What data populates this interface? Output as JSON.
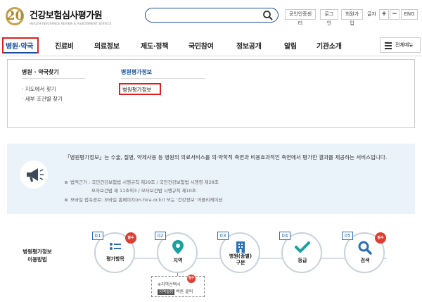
{
  "header": {
    "logo_number": "20",
    "logo_name": "건강보험심사평가원",
    "logo_sub": "HEALTH INSURANCE REVIEW & ASSESSMENT SERVICE",
    "search_placeholder": "",
    "utils": {
      "cert": "공인인증센터",
      "login": "로그인",
      "join": "회원가입",
      "font_label": "글자",
      "font_plus": "+",
      "font_minus": "−",
      "eng": "ENG"
    }
  },
  "gnb": {
    "items": [
      "병원·약국",
      "진료비",
      "의료정보",
      "제도·정책",
      "국민참여",
      "정보공개",
      "알림",
      "기관소개"
    ],
    "all_menu": "전체메뉴"
  },
  "dropdown": {
    "col1_title": "병원 · 약국찾기",
    "col1_links": [
      "지도에서 찾기",
      "세부 조건별 찾기"
    ],
    "col2_title": "병원평가정보",
    "col2_link": "병원평가정보"
  },
  "info": {
    "text": "「병원평가정보」는 수술, 질병, 약제사용 등 병원의 의료서비스를 의·약학적 측면과 비용효과적인 측면에서 평가한 결과를 제공하는 서비스입니다.",
    "law1": "법적근거 : 국민건강보험법 시행규칙 제29조 / 국민건강보험법 시행령 제28조",
    "law2": "모자보건법 제 11조의3 / 모자보건법 시행규칙 제10조",
    "mobile": "모바일 접속경로: 모바일 홈페이지(m.hira.or.kr) 또는 '건강정보' 어플리케이션"
  },
  "steps": {
    "title_line1": "병원평가정보",
    "title_line2": "이용방법",
    "required_label": "필수",
    "items": [
      {
        "num": "01",
        "label": "평가항목",
        "required": true
      },
      {
        "num": "02",
        "label": "지역",
        "required": false
      },
      {
        "num": "03",
        "label": "병원(종별)",
        "label2": "구분",
        "required": false
      },
      {
        "num": "04",
        "label": "등급",
        "required": false
      },
      {
        "num": "05",
        "label": "검색",
        "required": true
      }
    ],
    "note_line1": "지역선택시",
    "note_btn": "지역설정",
    "note_suffix": "버튼 클릭",
    "note_required": "필수"
  },
  "colors": {
    "brand_blue": "#1a4fa0",
    "highlight_red": "#e02020",
    "info_bg": "#eaf2fa",
    "step_blue": "#2d6fb8",
    "required_red": "#e03c31",
    "check_teal": "#17a2a0"
  }
}
